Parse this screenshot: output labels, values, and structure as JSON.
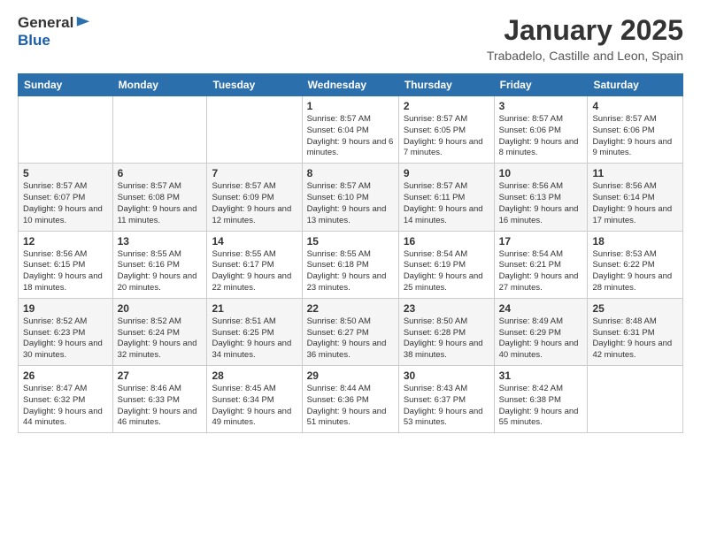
{
  "header": {
    "logo_line1": "General",
    "logo_line2": "Blue",
    "month": "January 2025",
    "location": "Trabadelo, Castille and Leon, Spain"
  },
  "weekdays": [
    "Sunday",
    "Monday",
    "Tuesday",
    "Wednesday",
    "Thursday",
    "Friday",
    "Saturday"
  ],
  "weeks": [
    [
      {
        "day": "",
        "info": ""
      },
      {
        "day": "",
        "info": ""
      },
      {
        "day": "",
        "info": ""
      },
      {
        "day": "1",
        "info": "Sunrise: 8:57 AM\nSunset: 6:04 PM\nDaylight: 9 hours and 6 minutes."
      },
      {
        "day": "2",
        "info": "Sunrise: 8:57 AM\nSunset: 6:05 PM\nDaylight: 9 hours and 7 minutes."
      },
      {
        "day": "3",
        "info": "Sunrise: 8:57 AM\nSunset: 6:06 PM\nDaylight: 9 hours and 8 minutes."
      },
      {
        "day": "4",
        "info": "Sunrise: 8:57 AM\nSunset: 6:06 PM\nDaylight: 9 hours and 9 minutes."
      }
    ],
    [
      {
        "day": "5",
        "info": "Sunrise: 8:57 AM\nSunset: 6:07 PM\nDaylight: 9 hours and 10 minutes."
      },
      {
        "day": "6",
        "info": "Sunrise: 8:57 AM\nSunset: 6:08 PM\nDaylight: 9 hours and 11 minutes."
      },
      {
        "day": "7",
        "info": "Sunrise: 8:57 AM\nSunset: 6:09 PM\nDaylight: 9 hours and 12 minutes."
      },
      {
        "day": "8",
        "info": "Sunrise: 8:57 AM\nSunset: 6:10 PM\nDaylight: 9 hours and 13 minutes."
      },
      {
        "day": "9",
        "info": "Sunrise: 8:57 AM\nSunset: 6:11 PM\nDaylight: 9 hours and 14 minutes."
      },
      {
        "day": "10",
        "info": "Sunrise: 8:56 AM\nSunset: 6:13 PM\nDaylight: 9 hours and 16 minutes."
      },
      {
        "day": "11",
        "info": "Sunrise: 8:56 AM\nSunset: 6:14 PM\nDaylight: 9 hours and 17 minutes."
      }
    ],
    [
      {
        "day": "12",
        "info": "Sunrise: 8:56 AM\nSunset: 6:15 PM\nDaylight: 9 hours and 18 minutes."
      },
      {
        "day": "13",
        "info": "Sunrise: 8:55 AM\nSunset: 6:16 PM\nDaylight: 9 hours and 20 minutes."
      },
      {
        "day": "14",
        "info": "Sunrise: 8:55 AM\nSunset: 6:17 PM\nDaylight: 9 hours and 22 minutes."
      },
      {
        "day": "15",
        "info": "Sunrise: 8:55 AM\nSunset: 6:18 PM\nDaylight: 9 hours and 23 minutes."
      },
      {
        "day": "16",
        "info": "Sunrise: 8:54 AM\nSunset: 6:19 PM\nDaylight: 9 hours and 25 minutes."
      },
      {
        "day": "17",
        "info": "Sunrise: 8:54 AM\nSunset: 6:21 PM\nDaylight: 9 hours and 27 minutes."
      },
      {
        "day": "18",
        "info": "Sunrise: 8:53 AM\nSunset: 6:22 PM\nDaylight: 9 hours and 28 minutes."
      }
    ],
    [
      {
        "day": "19",
        "info": "Sunrise: 8:52 AM\nSunset: 6:23 PM\nDaylight: 9 hours and 30 minutes."
      },
      {
        "day": "20",
        "info": "Sunrise: 8:52 AM\nSunset: 6:24 PM\nDaylight: 9 hours and 32 minutes."
      },
      {
        "day": "21",
        "info": "Sunrise: 8:51 AM\nSunset: 6:25 PM\nDaylight: 9 hours and 34 minutes."
      },
      {
        "day": "22",
        "info": "Sunrise: 8:50 AM\nSunset: 6:27 PM\nDaylight: 9 hours and 36 minutes."
      },
      {
        "day": "23",
        "info": "Sunrise: 8:50 AM\nSunset: 6:28 PM\nDaylight: 9 hours and 38 minutes."
      },
      {
        "day": "24",
        "info": "Sunrise: 8:49 AM\nSunset: 6:29 PM\nDaylight: 9 hours and 40 minutes."
      },
      {
        "day": "25",
        "info": "Sunrise: 8:48 AM\nSunset: 6:31 PM\nDaylight: 9 hours and 42 minutes."
      }
    ],
    [
      {
        "day": "26",
        "info": "Sunrise: 8:47 AM\nSunset: 6:32 PM\nDaylight: 9 hours and 44 minutes."
      },
      {
        "day": "27",
        "info": "Sunrise: 8:46 AM\nSunset: 6:33 PM\nDaylight: 9 hours and 46 minutes."
      },
      {
        "day": "28",
        "info": "Sunrise: 8:45 AM\nSunset: 6:34 PM\nDaylight: 9 hours and 49 minutes."
      },
      {
        "day": "29",
        "info": "Sunrise: 8:44 AM\nSunset: 6:36 PM\nDaylight: 9 hours and 51 minutes."
      },
      {
        "day": "30",
        "info": "Sunrise: 8:43 AM\nSunset: 6:37 PM\nDaylight: 9 hours and 53 minutes."
      },
      {
        "day": "31",
        "info": "Sunrise: 8:42 AM\nSunset: 6:38 PM\nDaylight: 9 hours and 55 minutes."
      },
      {
        "day": "",
        "info": ""
      }
    ]
  ]
}
